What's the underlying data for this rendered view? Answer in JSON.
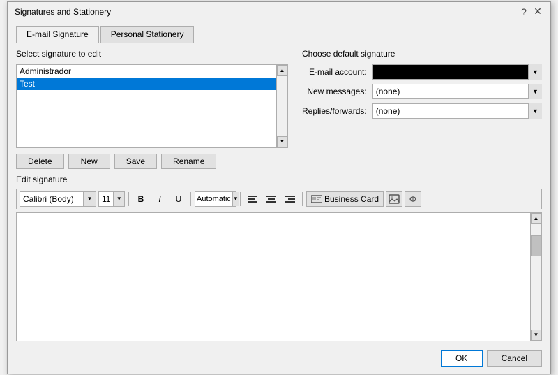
{
  "dialog": {
    "title": "Signatures and Stationery",
    "help_symbol": "?",
    "close_symbol": "✕"
  },
  "tabs": {
    "email_signature": "E-mail Signature",
    "personal_stationery": "Personal Stationery",
    "active": 0
  },
  "left_panel": {
    "section_label": "Select signature to edit",
    "signatures": [
      {
        "name": "Administrador",
        "selected": false
      },
      {
        "name": "Test",
        "selected": true
      }
    ],
    "buttons": {
      "delete": "Delete",
      "new": "New",
      "save": "Save",
      "rename": "Rename"
    }
  },
  "right_panel": {
    "section_label": "Choose default signature",
    "email_account_label": "E-mail account:",
    "email_account_value": "",
    "new_messages_label": "New messages:",
    "new_messages_value": "(none)",
    "replies_forwards_label": "Replies/forwards:",
    "replies_forwards_value": "(none)",
    "dropdown_options": [
      "(none)"
    ]
  },
  "edit_section": {
    "label": "Edit signature",
    "font_name": "Calibri (Body)",
    "font_size": "11",
    "bold": "B",
    "italic": "I",
    "underline": "U",
    "color_label": "Automatic",
    "align_left": "≡",
    "align_center": "≡",
    "align_right": "≡",
    "business_card_label": "Business Card",
    "insert_image_title": "Insert image",
    "hyperlink_title": "Insert hyperlink"
  },
  "bottom_buttons": {
    "ok": "OK",
    "cancel": "Cancel"
  }
}
